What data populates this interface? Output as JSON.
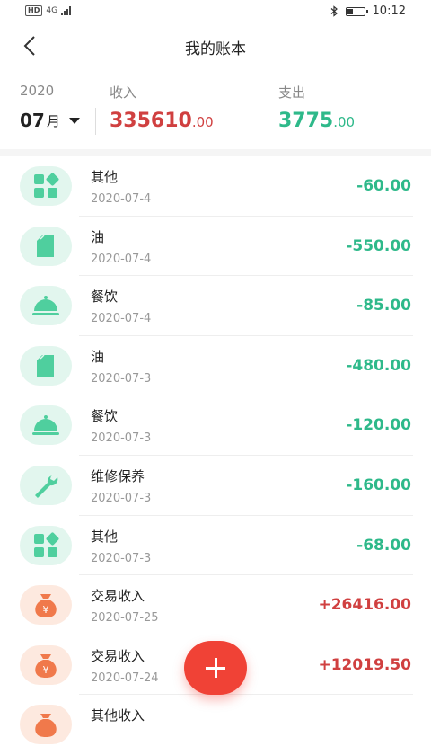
{
  "status": {
    "network": "4G",
    "time": "10:12"
  },
  "header": {
    "title": "我的账本"
  },
  "summary": {
    "year": "2020",
    "month": "07",
    "month_unit": "月",
    "income_label": "收入",
    "income_value": "335610",
    "income_cents": ".00",
    "expense_label": "支出",
    "expense_value": "3775",
    "expense_cents": ".00"
  },
  "colors": {
    "income": "#d04040",
    "expense": "#2eb98a",
    "fab": "#f04236"
  },
  "records": [
    {
      "title": "其他",
      "date": "2020-07-4",
      "amount": "-60.00",
      "icon": "grid-icon",
      "kind": "expense"
    },
    {
      "title": "油",
      "date": "2020-07-4",
      "amount": "-550.00",
      "icon": "fuel-can-icon",
      "kind": "expense"
    },
    {
      "title": "餐饮",
      "date": "2020-07-4",
      "amount": "-85.00",
      "icon": "food-cloche-icon",
      "kind": "expense"
    },
    {
      "title": "油",
      "date": "2020-07-3",
      "amount": "-480.00",
      "icon": "fuel-can-icon",
      "kind": "expense"
    },
    {
      "title": "餐饮",
      "date": "2020-07-3",
      "amount": "-120.00",
      "icon": "food-cloche-icon",
      "kind": "expense"
    },
    {
      "title": "维修保养",
      "date": "2020-07-3",
      "amount": "-160.00",
      "icon": "wrench-icon",
      "kind": "expense"
    },
    {
      "title": "其他",
      "date": "2020-07-3",
      "amount": "-68.00",
      "icon": "grid-icon",
      "kind": "expense"
    },
    {
      "title": "交易收入",
      "date": "2020-07-25",
      "amount": "+26416.00",
      "icon": "money-bag-icon",
      "kind": "income"
    },
    {
      "title": "交易收入",
      "date": "2020-07-24",
      "amount": "+12019.50",
      "icon": "money-bag-icon",
      "kind": "income"
    },
    {
      "title": "其他收入",
      "date": "",
      "amount": "",
      "icon": "money-bag-icon",
      "kind": "income"
    }
  ]
}
